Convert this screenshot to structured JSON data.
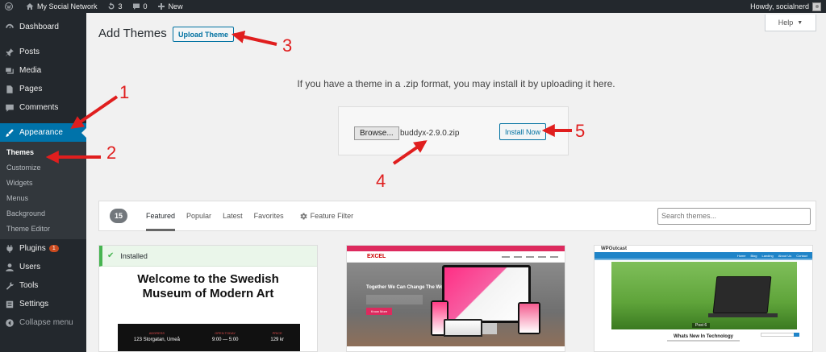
{
  "admin_bar": {
    "site_name": "My Social Network",
    "updates_count": "3",
    "comments_count": "0",
    "new_label": "New",
    "howdy": "Howdy, socialnerd"
  },
  "sidebar": {
    "items": [
      {
        "label": "Dashboard",
        "icon": "dashboard-icon"
      },
      {
        "label": "Posts",
        "icon": "pin-icon"
      },
      {
        "label": "Media",
        "icon": "media-icon"
      },
      {
        "label": "Pages",
        "icon": "page-icon"
      },
      {
        "label": "Comments",
        "icon": "comment-icon"
      },
      {
        "label": "Appearance",
        "icon": "brush-icon"
      }
    ],
    "appearance_submenu": [
      "Themes",
      "Customize",
      "Widgets",
      "Menus",
      "Background",
      "Theme Editor"
    ],
    "items_after": [
      {
        "label": "Plugins",
        "icon": "plugin-icon",
        "badge": "1"
      },
      {
        "label": "Users",
        "icon": "users-icon"
      },
      {
        "label": "Tools",
        "icon": "tools-icon"
      },
      {
        "label": "Settings",
        "icon": "settings-icon"
      },
      {
        "label": "Collapse menu",
        "icon": "collapse-icon"
      }
    ]
  },
  "header": {
    "title": "Add Themes",
    "upload_button": "Upload Theme",
    "help": "Help"
  },
  "upload": {
    "message": "If you have a theme in a .zip format, you may install it by uploading it here.",
    "browse_label": "Browse...",
    "file_name": "buddyx-2.9.0.zip",
    "install_label": "Install Now"
  },
  "filter": {
    "count": "15",
    "tabs": [
      "Featured",
      "Popular",
      "Latest",
      "Favorites"
    ],
    "feature_filter": "Feature Filter",
    "search_placeholder": "Search themes..."
  },
  "themes": {
    "card1": {
      "installed": "Installed",
      "title_line1": "Welcome to the Swedish",
      "title_line2": "Museum of Modern Art",
      "cols": [
        {
          "head": "ADDRESS",
          "val": "123 Storgatan, Umeå"
        },
        {
          "head": "OPEN TODAY",
          "val": "9:00 — 5:00"
        },
        {
          "head": "PRICE",
          "val": "129 kr"
        }
      ]
    },
    "card2": {
      "logo": "EXCEL",
      "hero_text": "Together We Can Change The World.",
      "hero_button": "Know More"
    },
    "card3": {
      "logo": "WPOutcast",
      "nav": [
        "Home",
        "Blog",
        "Landing",
        "About Us",
        "Contact"
      ],
      "caption": "Post 6",
      "post_title": "Whats New In Technology"
    }
  },
  "annotations": [
    "1",
    "2",
    "3",
    "4",
    "5"
  ],
  "colors": {
    "adminbar": "#23282d",
    "accent": "#0073aa",
    "annotation": "#e01e1e"
  }
}
